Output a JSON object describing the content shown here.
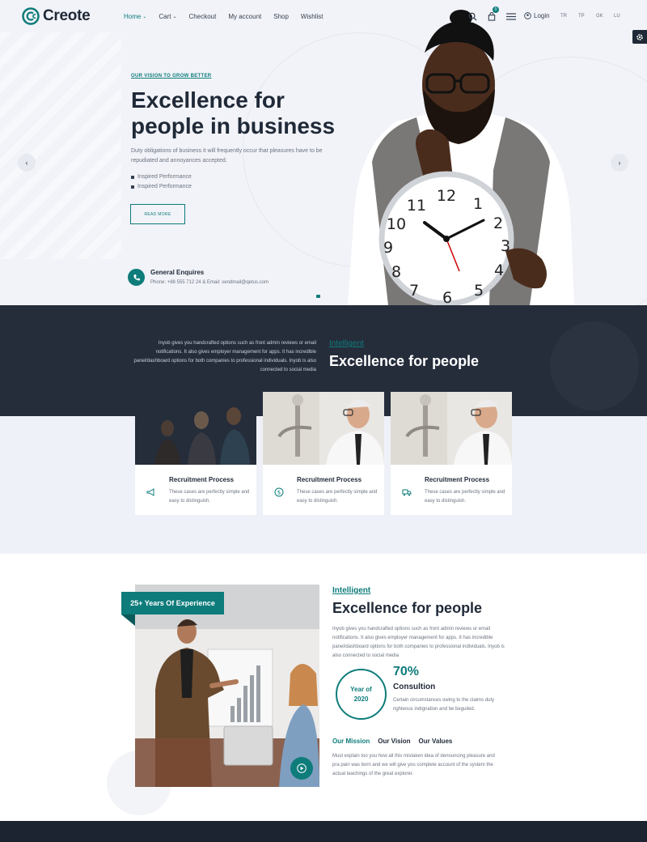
{
  "brand": {
    "name": "Creote",
    "accent": "#0e7c7b",
    "dark": "#252d3b"
  },
  "nav": {
    "items": [
      {
        "label": "Home",
        "caret": "⌄",
        "active": true
      },
      {
        "label": "Cart",
        "caret": "⌄",
        "active": false
      },
      {
        "label": "Checkout",
        "caret": "",
        "active": false
      },
      {
        "label": "My account",
        "caret": "",
        "active": false
      },
      {
        "label": "Shop",
        "caret": "",
        "active": false
      },
      {
        "label": "Wishlist",
        "caret": "",
        "active": false
      }
    ],
    "cart_count": "0",
    "login_label": "Login",
    "languages": [
      "TR",
      "TP",
      "GK",
      "LU"
    ]
  },
  "hero": {
    "tagline": "OUR VISION TO GROW BETTER",
    "title": "Excellence for people in business",
    "description": "Duty obligations of business it will frequently occur that pleasures have to be repudiated and annoyances accepted.",
    "bullets": [
      "Inspired Performance",
      "Inspired Performance"
    ],
    "button_label": "READ MORE",
    "prev_icon": "chevron-left-icon",
    "next_icon": "chevron-right-icon",
    "prev_label": "‹",
    "next_label": "›",
    "enquire_title": "General Enquires",
    "enquire_text": "Phone: +88 555 712 24 & Email: sendmail@qetus.com"
  },
  "intro": {
    "text": "Inyob gives you handcrafted options such as front admin reviews or email notifications. It also gives employer management for apps. It has incredible panel/dashboard options for both companies to professional individuals. Inyob is also connected to social media",
    "tag": "Intelligent",
    "title": "Excellence for people"
  },
  "cards": [
    {
      "title": "Recruitment Process",
      "text": "These cases are perfectly simple and easy to distinguish.",
      "icon": "megaphone-icon"
    },
    {
      "title": "Recruitment Process",
      "text": "These cases are perfectly simple and easy to distinguish.",
      "icon": "dollar-icon"
    },
    {
      "title": "Recruitment Process",
      "text": "These cases are perfectly simple and easy to distinguish.",
      "icon": "truck-icon"
    }
  ],
  "about": {
    "experience_badge": "25+ Years Of Experience",
    "tag": "Intelligent",
    "title": "Excellence for people",
    "description": "Inyob gives you handcrafted options such as front admin reviews or email notifications. It also gives employer management for apps. It has incredible panel/dashboard options for both companies to professional individuals. Inyob is also connected to social media",
    "year_line1": "Year of",
    "year_line2": "2020",
    "percent": "70%",
    "percent_label": "Consultion",
    "percent_text": "Certain circumstances owing to the claims duty righteous indignation and be beguiled.",
    "tabs": [
      "Our Mission",
      "Our Vision",
      "Our Values"
    ],
    "mission_text": "Must explain too you how all this mistaken idea of denouncing pleasure and pra pain was born and we will give you complete account of the system the actual teachings of the great explorer."
  }
}
